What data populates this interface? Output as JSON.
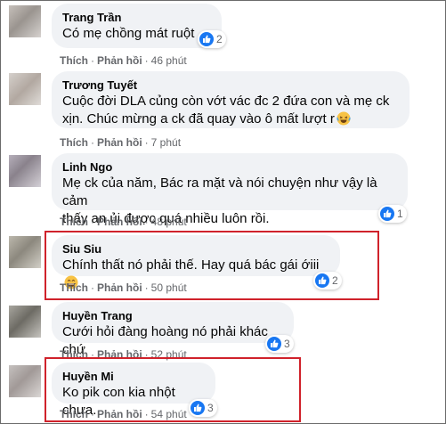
{
  "comments": [
    {
      "name": "Trang Trần",
      "lines": [
        "Có mẹ chồng mát ruột"
      ],
      "like": "Thích",
      "reply": "Phản hồi",
      "time": "46 phút",
      "reactions": "2"
    },
    {
      "name": "Trương Tuyết",
      "lines": [
        "Cuộc đời DLA củng còn vớt vác đc 2 đứa con và mẹ ck",
        "xịn. Chúc mừng a ck đã quay vào ô mất lượt r"
      ],
      "like": "Thích",
      "reply": "Phản hồi",
      "time": "7 phút",
      "emoji": "laughing-emoji"
    },
    {
      "name": "Linh Ngo",
      "lines": [
        "Mẹ ck của năm, Bác ra mặt và nói chuyện như vậy là cảm",
        "thấy an ủi được quá nhiều luôn rồi."
      ],
      "like": "Thích",
      "reply": "Phản hồi",
      "time": "48 phút",
      "reactions": "1"
    },
    {
      "name": "Siu Siu",
      "lines": [
        "Chính thất nó phải thế. Hay quá bác gái ớiii"
      ],
      "like": "Thích",
      "reply": "Phản hồi",
      "time": "50 phút",
      "reactions": "2",
      "emoji": "grinning-emoji"
    },
    {
      "name": "Huyền Trang",
      "lines": [
        "Cưới hỏi đàng hoàng nó phải khác chứ"
      ],
      "like": "Thích",
      "reply": "Phản hồi",
      "time": "52 phút",
      "reactions": "3"
    },
    {
      "name": "Huyền Mi",
      "lines": [
        "Ko pik con kia nhột chưa."
      ],
      "like": "Thích",
      "reply": "Phản hồi",
      "time": "54 phút",
      "reactions": "3"
    }
  ],
  "colors": {
    "highlight": "#d0222b",
    "like": "#1877f2",
    "bubble": "#f0f2f5"
  },
  "icons": {
    "like": "thumbs-up-icon"
  }
}
